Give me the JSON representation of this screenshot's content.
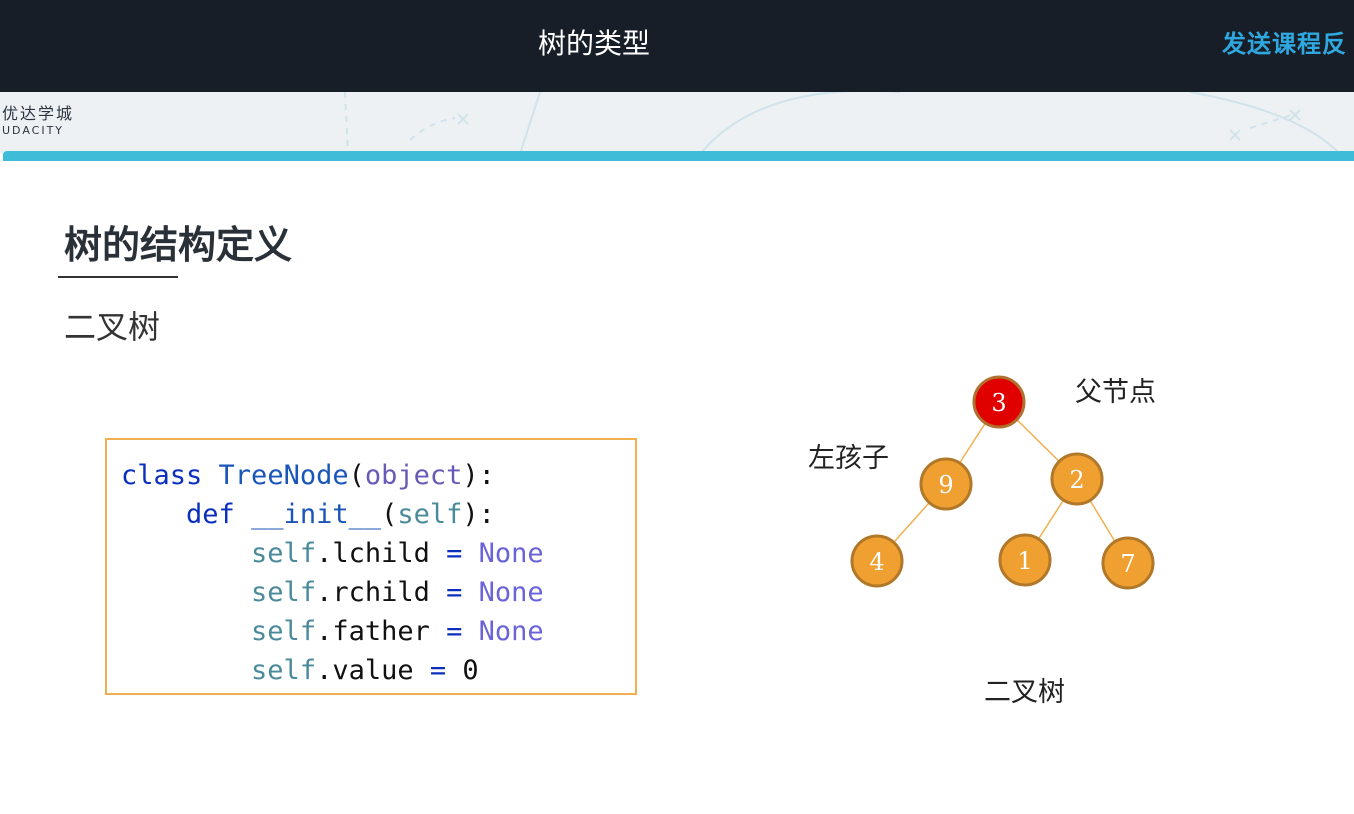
{
  "window": {
    "title": "树的类型",
    "feedback_link": "发送课程反"
  },
  "brand": {
    "name_cn": "优达学城",
    "name_en": "UDACITY"
  },
  "slide": {
    "heading": "树的结构定义",
    "subheading": "二叉树",
    "code_lines": [
      "class TreeNode(object):",
      "    def __init__(self):",
      "        self.lchild = None",
      "        self.rchild = None",
      "        self.father = None",
      "        self.value = 0"
    ],
    "diagram": {
      "parent_label": "父节点",
      "left_child_label": "左孩子",
      "caption": "二叉树",
      "nodes": [
        {
          "id": "root",
          "value": "3",
          "color": "#e00000"
        },
        {
          "id": "n9",
          "value": "9",
          "color": "#f0a030"
        },
        {
          "id": "n2",
          "value": "2",
          "color": "#f0a030"
        },
        {
          "id": "n4",
          "value": "4",
          "color": "#f0a030"
        },
        {
          "id": "n1",
          "value": "1",
          "color": "#f0a030"
        },
        {
          "id": "n7",
          "value": "7",
          "color": "#f0a030"
        }
      ]
    }
  },
  "colors": {
    "topbar": "#171e27",
    "accent": "#3fbcd8",
    "feedback": "#2fa8e0"
  }
}
